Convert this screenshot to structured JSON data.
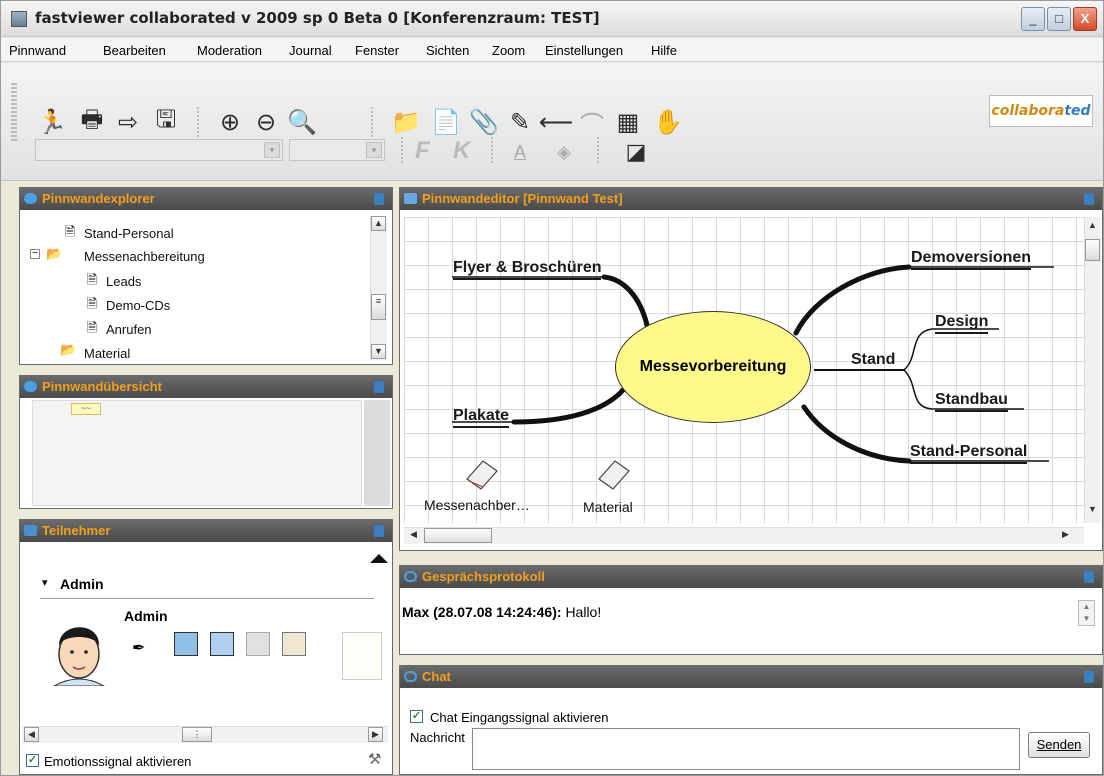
{
  "window": {
    "title": "fastviewer collaborated v 2009 sp 0 Beta 0 [Konferenzraum: TEST]",
    "min_label": "_",
    "max_label": "□",
    "close_label": "X"
  },
  "menu": [
    "Pinnwand",
    "Bearbeiten",
    "Moderation",
    "Journal",
    "Fenster",
    "Sichten",
    "Zoom",
    "Einstellungen",
    "Hilfe"
  ],
  "toolbar": {
    "format_bold": "F",
    "format_italic": "K",
    "logo_prefix": "collabora",
    "logo_o": "ted"
  },
  "explorer": {
    "title": "Pinnwandexplorer",
    "items": [
      "Stand-Personal",
      "Messenachbereitung",
      "Leads",
      "Demo-CDs",
      "Anrufen",
      "Material"
    ]
  },
  "overview": {
    "title": "Pinnwandübersicht"
  },
  "participants": {
    "title": "Teilnehmer",
    "group": "Admin",
    "user_name": "Admin",
    "emotion_label": "Emotionssignal aktivieren"
  },
  "editor": {
    "title": "Pinnwandeditor [Pinnwand Test]",
    "center": "Messevorbereitung",
    "nodes": {
      "flyer": "Flyer & Broschüren",
      "plakate": "Plakate",
      "demoversionen": "Demoversionen",
      "stand": "Stand",
      "design": "Design",
      "standbau": "Standbau",
      "stand_personal": "Stand-Personal"
    },
    "notes": [
      "Messenachber…",
      "Material"
    ]
  },
  "protocol": {
    "title": "Gesprächsprotokoll",
    "sender": "Max (28.07.08 14:24:46):",
    "message": "Hallo!"
  },
  "chat": {
    "title": "Chat",
    "signal_label": "Chat Eingangssignal aktivieren",
    "message_label": "Nachricht",
    "send_label": "Senden"
  },
  "colors": {
    "panel_header": "#4a4a4a",
    "panel_title": "#f0a020",
    "center_node": "#fff88a"
  }
}
